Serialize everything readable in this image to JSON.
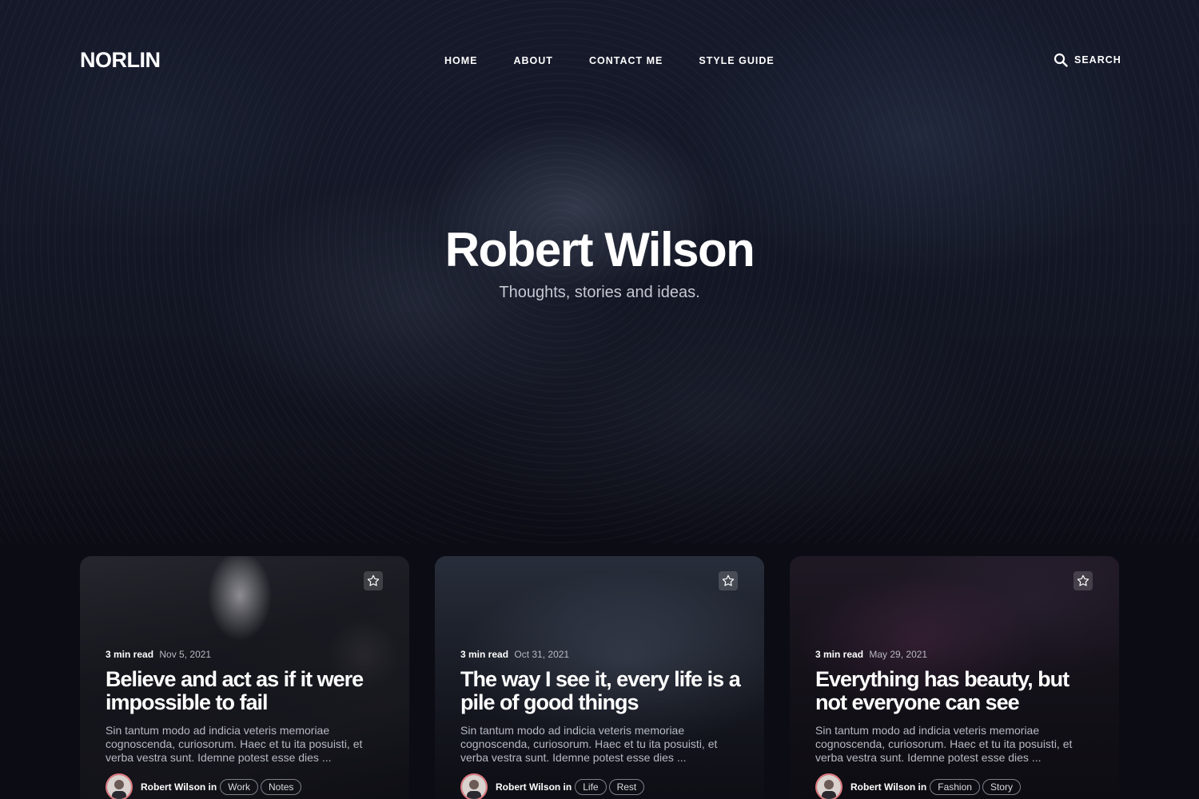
{
  "header": {
    "logo": "NORLIN",
    "nav": [
      "HOME",
      "ABOUT",
      "CONTACT ME",
      "STYLE GUIDE"
    ],
    "search_label": "SEARCH"
  },
  "hero": {
    "title": "Robert Wilson",
    "subtitle": "Thoughts, stories and ideas."
  },
  "posts": [
    {
      "read_time": "3 min read",
      "date": "Nov 5, 2021",
      "title": "Believe and act as if it were impossible to fail",
      "excerpt": "Sin tantum modo ad indicia veteris memoriae cognoscenda, curiosorum. Haec et tu ita posuisti, et verba vestra sunt. Idemne potest esse dies ...",
      "author": "Robert Wilson in",
      "tags": [
        "Work",
        "Notes"
      ]
    },
    {
      "read_time": "3 min read",
      "date": "Oct 31, 2021",
      "title": "The way I see it, every life is a pile of good things",
      "excerpt": "Sin tantum modo ad indicia veteris memoriae cognoscenda, curiosorum. Haec et tu ita posuisti, et verba vestra sunt. Idemne potest esse dies ...",
      "author": "Robert Wilson in",
      "tags": [
        "Life",
        "Rest"
      ]
    },
    {
      "read_time": "3 min read",
      "date": "May 29, 2021",
      "title": "Everything has beauty, but not everyone can see",
      "excerpt": "Sin tantum modo ad indicia veteris memoriae cognoscenda, curiosorum. Haec et tu ita posuisti, et verba vestra sunt. Idemne potest esse dies ...",
      "author": "Robert Wilson in",
      "tags": [
        "Fashion",
        "Story"
      ]
    }
  ],
  "icons": {
    "search": "search-icon",
    "star": "star-icon",
    "avatar": "avatar"
  },
  "colors": {
    "background": "#0b0c14",
    "avatar_ring": "#e07a80"
  }
}
